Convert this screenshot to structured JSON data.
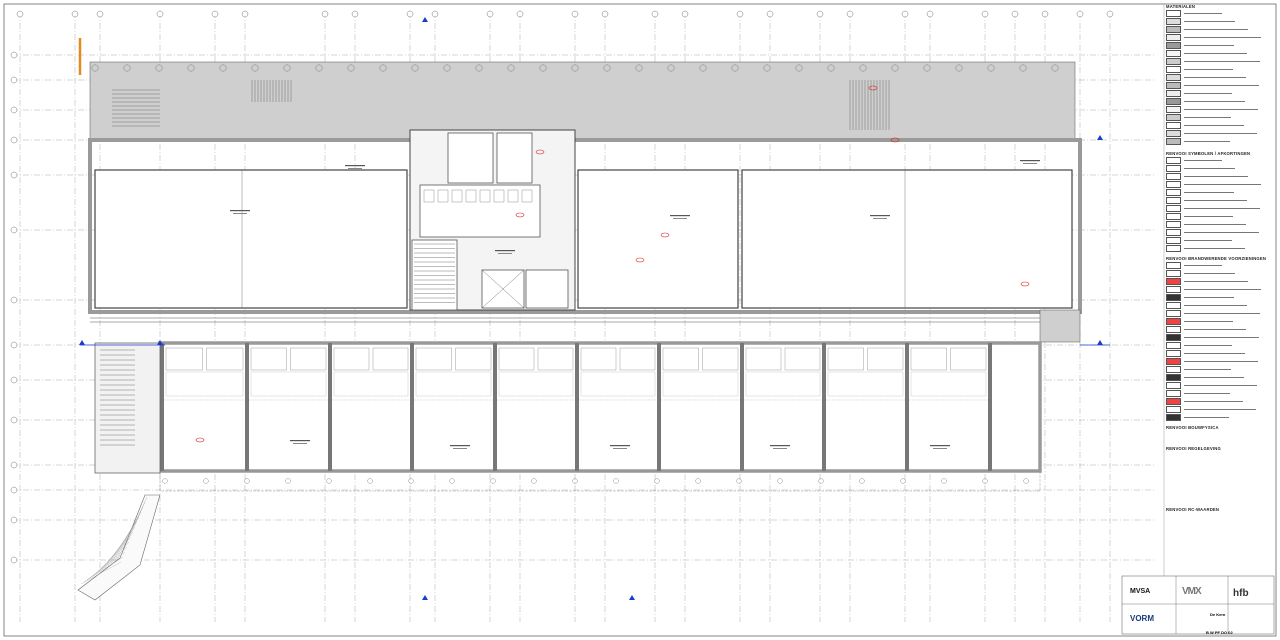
{
  "drawing": {
    "grid_labels_top": [
      "D",
      "E",
      "F",
      "G",
      "H",
      "I",
      "J",
      "K",
      "L",
      "M",
      "N",
      "O",
      "P",
      "Q",
      "R",
      "S"
    ],
    "grid_labels_side": [
      "1",
      "2",
      "3",
      "4",
      "5",
      "6",
      "7",
      "8",
      "9"
    ],
    "section_marks": [
      "C-C",
      "C-C",
      "E-E",
      "E-E",
      "D-D",
      "D-D"
    ],
    "colors": {
      "line": "#555555",
      "wall": "#9a9a9a",
      "hatch": "#cfcfcf",
      "red": "#d62020",
      "blue": "#1a3ad0",
      "orange": "#e08a20"
    }
  },
  "legend": {
    "title_materials": "MATERIALEN",
    "title_symbols": "RENVOOI SYMBOLEN / AFKORTINGEN",
    "title_fire": "RENVOOI BRANDWERENDE VOORZIENINGEN",
    "title_bouwfysica": "RENVOOI BOUWFYSICA",
    "title_regelgeving": "RENVOOI REGELGEVING",
    "title_rc": "RENVOOI RC-WAARDEN"
  },
  "titleblock": {
    "mvsa": "MVSA",
    "vorm": "VORM",
    "mx": "VMX",
    "hfb": "hfb",
    "project": "De Kern",
    "code": "B W PF DO 02"
  }
}
